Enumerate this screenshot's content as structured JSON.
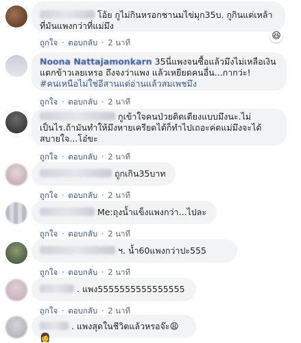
{
  "actions": {
    "like": "ถูกใจ",
    "dot": "·",
    "reply": "ตอบกลับ",
    "time": "2 นาที"
  },
  "comments": [
    {
      "name": "ี ี ี",
      "text": "โอ้ย กูไม่กินหรอกชานมไข่มุก35บ. กูกินแต่เหล้าที่มันแพงกว่าที่แม่มึง",
      "reaction": "😆"
    },
    {
      "name": "Noona Nattajamonkarn",
      "text": "35นี่แพงจนซื้อแล้วมึงไม่เหลือเงินแดกข้าวเลยเหรอ ถึงจงว่าแพง แล้วเหยียดคนอื่น...กากว่ะ!",
      "hashtag": "#คนเหนือไม่ใช่อีสานแต่อ่านแล้วสมเพชมึง"
    },
    {
      "name": "",
      "text": "กูเข้าใจคนป่วยติดเตียงแบบมึงนะ.ไม่เป็นไร.ถ้ามันทำให้มึงหายเครียดได้ก็ทำไปเถอะค่ดแม่มึงจะได้สบายใจ...โอ๋ขะ"
    },
    {
      "name": "",
      "text": "ถูกเกิน35บาท"
    },
    {
      "name": "",
      "text": "Me:ถุงน้ำแข็งแพงกว่า...ไปละ"
    },
    {
      "name": "",
      "text": "ฯ. น้ำ60แพงกว่าปะ555"
    },
    {
      "name": "",
      "text": ". แพง5555555555555555"
    },
    {
      "name": "",
      "text": ". แพงสุดในชีวิตแล้วหรอจ๊ะ😩👩"
    }
  ]
}
